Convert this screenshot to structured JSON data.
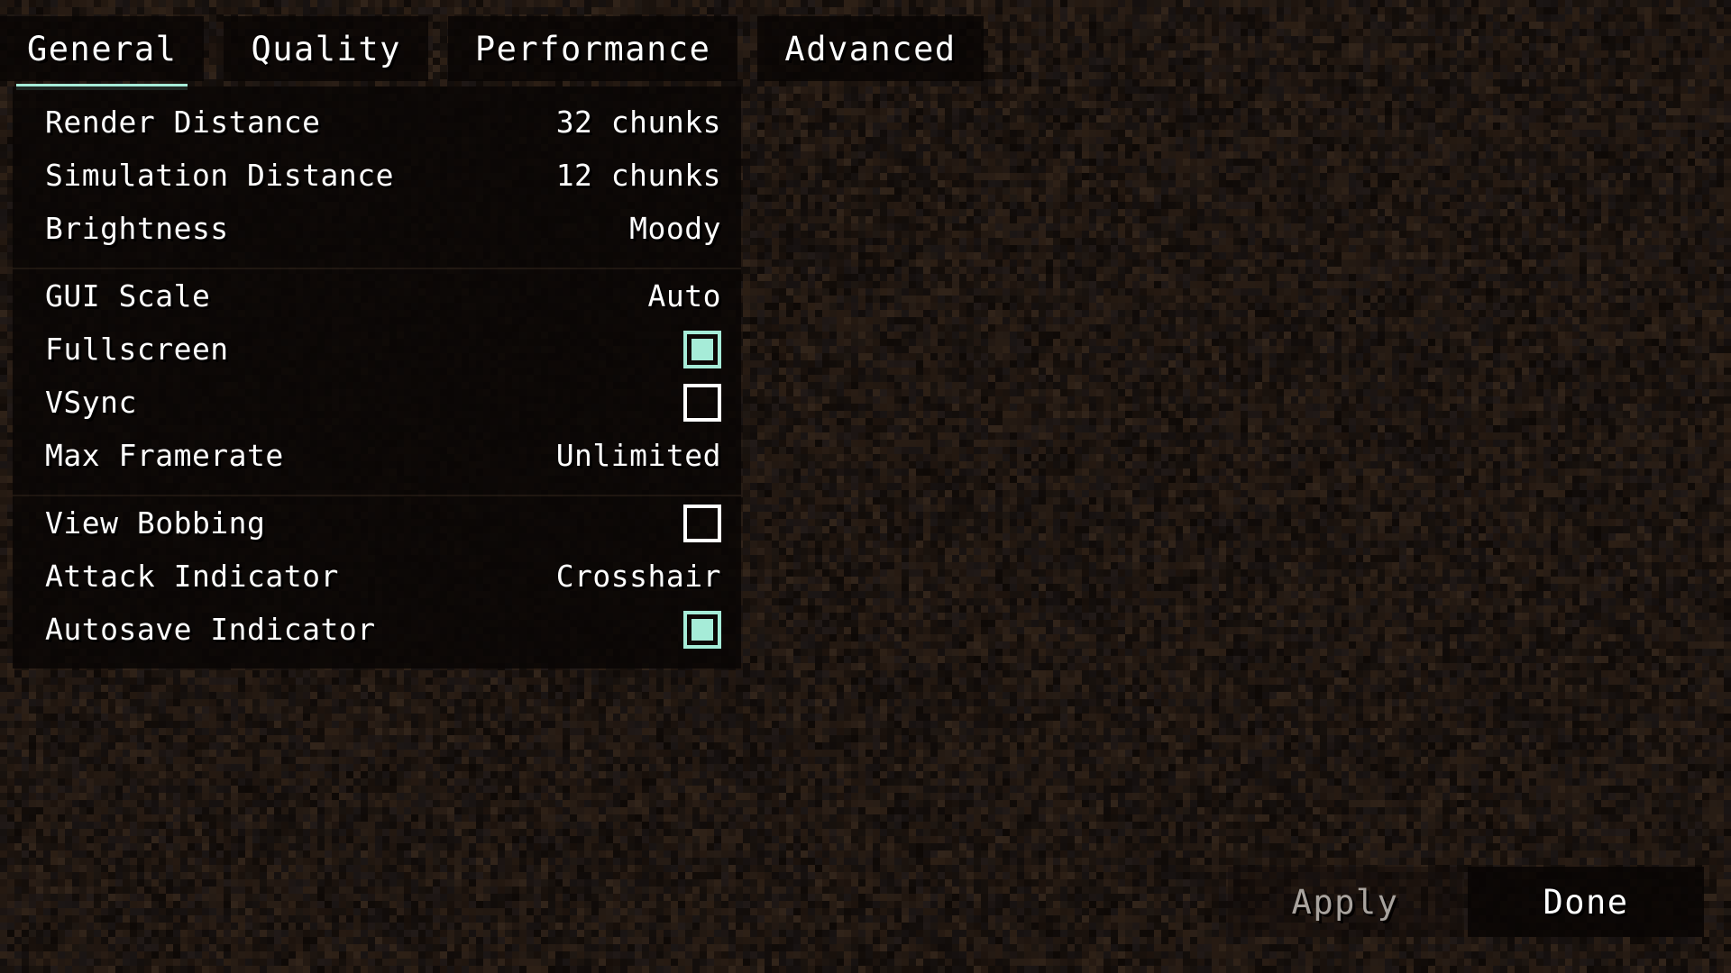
{
  "theme": {
    "accent": "#a6ecd8",
    "text": "#ffffff",
    "disabled_text": "#a8a39e",
    "panel_bg": "#090605",
    "background": "#1c1410"
  },
  "tabs": [
    {
      "id": "general",
      "label": "General",
      "active": true
    },
    {
      "id": "quality",
      "label": "Quality",
      "active": false
    },
    {
      "id": "performance",
      "label": "Performance",
      "active": false
    },
    {
      "id": "advanced",
      "label": "Advanced",
      "active": false
    }
  ],
  "groups": [
    {
      "id": "group-distance",
      "rows": [
        {
          "id": "render-distance",
          "label": "Render Distance",
          "type": "value",
          "value": "32 chunks"
        },
        {
          "id": "simulation-distance",
          "label": "Simulation Distance",
          "type": "value",
          "value": "12 chunks"
        },
        {
          "id": "brightness",
          "label": "Brightness",
          "type": "value",
          "value": "Moody"
        }
      ]
    },
    {
      "id": "group-display",
      "rows": [
        {
          "id": "gui-scale",
          "label": "GUI Scale",
          "type": "value",
          "value": "Auto"
        },
        {
          "id": "fullscreen",
          "label": "Fullscreen",
          "type": "checkbox",
          "checked": true
        },
        {
          "id": "vsync",
          "label": "VSync",
          "type": "checkbox",
          "checked": false
        },
        {
          "id": "max-framerate",
          "label": "Max Framerate",
          "type": "value",
          "value": "Unlimited"
        }
      ]
    },
    {
      "id": "group-gameplay",
      "rows": [
        {
          "id": "view-bobbing",
          "label": "View Bobbing",
          "type": "checkbox",
          "checked": false
        },
        {
          "id": "attack-indicator",
          "label": "Attack Indicator",
          "type": "value",
          "value": "Crosshair"
        },
        {
          "id": "autosave-indicator",
          "label": "Autosave Indicator",
          "type": "checkbox",
          "checked": true
        }
      ]
    }
  ],
  "footer": {
    "apply_label": "Apply",
    "apply_enabled": false,
    "done_label": "Done",
    "done_enabled": true
  }
}
